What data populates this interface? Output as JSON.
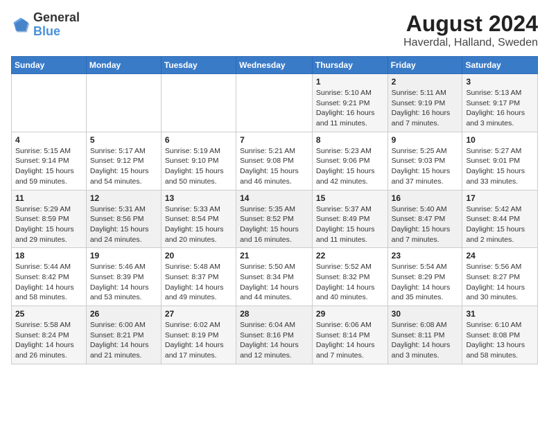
{
  "logo": {
    "line1": "General",
    "line2": "Blue"
  },
  "title": "August 2024",
  "subtitle": "Haverdal, Halland, Sweden",
  "headers": [
    "Sunday",
    "Monday",
    "Tuesday",
    "Wednesday",
    "Thursday",
    "Friday",
    "Saturday"
  ],
  "weeks": [
    [
      {
        "num": "",
        "info": ""
      },
      {
        "num": "",
        "info": ""
      },
      {
        "num": "",
        "info": ""
      },
      {
        "num": "",
        "info": ""
      },
      {
        "num": "1",
        "info": "Sunrise: 5:10 AM\nSunset: 9:21 PM\nDaylight: 16 hours\nand 11 minutes."
      },
      {
        "num": "2",
        "info": "Sunrise: 5:11 AM\nSunset: 9:19 PM\nDaylight: 16 hours\nand 7 minutes."
      },
      {
        "num": "3",
        "info": "Sunrise: 5:13 AM\nSunset: 9:17 PM\nDaylight: 16 hours\nand 3 minutes."
      }
    ],
    [
      {
        "num": "4",
        "info": "Sunrise: 5:15 AM\nSunset: 9:14 PM\nDaylight: 15 hours\nand 59 minutes."
      },
      {
        "num": "5",
        "info": "Sunrise: 5:17 AM\nSunset: 9:12 PM\nDaylight: 15 hours\nand 54 minutes."
      },
      {
        "num": "6",
        "info": "Sunrise: 5:19 AM\nSunset: 9:10 PM\nDaylight: 15 hours\nand 50 minutes."
      },
      {
        "num": "7",
        "info": "Sunrise: 5:21 AM\nSunset: 9:08 PM\nDaylight: 15 hours\nand 46 minutes."
      },
      {
        "num": "8",
        "info": "Sunrise: 5:23 AM\nSunset: 9:06 PM\nDaylight: 15 hours\nand 42 minutes."
      },
      {
        "num": "9",
        "info": "Sunrise: 5:25 AM\nSunset: 9:03 PM\nDaylight: 15 hours\nand 37 minutes."
      },
      {
        "num": "10",
        "info": "Sunrise: 5:27 AM\nSunset: 9:01 PM\nDaylight: 15 hours\nand 33 minutes."
      }
    ],
    [
      {
        "num": "11",
        "info": "Sunrise: 5:29 AM\nSunset: 8:59 PM\nDaylight: 15 hours\nand 29 minutes."
      },
      {
        "num": "12",
        "info": "Sunrise: 5:31 AM\nSunset: 8:56 PM\nDaylight: 15 hours\nand 24 minutes."
      },
      {
        "num": "13",
        "info": "Sunrise: 5:33 AM\nSunset: 8:54 PM\nDaylight: 15 hours\nand 20 minutes."
      },
      {
        "num": "14",
        "info": "Sunrise: 5:35 AM\nSunset: 8:52 PM\nDaylight: 15 hours\nand 16 minutes."
      },
      {
        "num": "15",
        "info": "Sunrise: 5:37 AM\nSunset: 8:49 PM\nDaylight: 15 hours\nand 11 minutes."
      },
      {
        "num": "16",
        "info": "Sunrise: 5:40 AM\nSunset: 8:47 PM\nDaylight: 15 hours\nand 7 minutes."
      },
      {
        "num": "17",
        "info": "Sunrise: 5:42 AM\nSunset: 8:44 PM\nDaylight: 15 hours\nand 2 minutes."
      }
    ],
    [
      {
        "num": "18",
        "info": "Sunrise: 5:44 AM\nSunset: 8:42 PM\nDaylight: 14 hours\nand 58 minutes."
      },
      {
        "num": "19",
        "info": "Sunrise: 5:46 AM\nSunset: 8:39 PM\nDaylight: 14 hours\nand 53 minutes."
      },
      {
        "num": "20",
        "info": "Sunrise: 5:48 AM\nSunset: 8:37 PM\nDaylight: 14 hours\nand 49 minutes."
      },
      {
        "num": "21",
        "info": "Sunrise: 5:50 AM\nSunset: 8:34 PM\nDaylight: 14 hours\nand 44 minutes."
      },
      {
        "num": "22",
        "info": "Sunrise: 5:52 AM\nSunset: 8:32 PM\nDaylight: 14 hours\nand 40 minutes."
      },
      {
        "num": "23",
        "info": "Sunrise: 5:54 AM\nSunset: 8:29 PM\nDaylight: 14 hours\nand 35 minutes."
      },
      {
        "num": "24",
        "info": "Sunrise: 5:56 AM\nSunset: 8:27 PM\nDaylight: 14 hours\nand 30 minutes."
      }
    ],
    [
      {
        "num": "25",
        "info": "Sunrise: 5:58 AM\nSunset: 8:24 PM\nDaylight: 14 hours\nand 26 minutes."
      },
      {
        "num": "26",
        "info": "Sunrise: 6:00 AM\nSunset: 8:21 PM\nDaylight: 14 hours\nand 21 minutes."
      },
      {
        "num": "27",
        "info": "Sunrise: 6:02 AM\nSunset: 8:19 PM\nDaylight: 14 hours\nand 17 minutes."
      },
      {
        "num": "28",
        "info": "Sunrise: 6:04 AM\nSunset: 8:16 PM\nDaylight: 14 hours\nand 12 minutes."
      },
      {
        "num": "29",
        "info": "Sunrise: 6:06 AM\nSunset: 8:14 PM\nDaylight: 14 hours\nand 7 minutes."
      },
      {
        "num": "30",
        "info": "Sunrise: 6:08 AM\nSunset: 8:11 PM\nDaylight: 14 hours\nand 3 minutes."
      },
      {
        "num": "31",
        "info": "Sunrise: 6:10 AM\nSunset: 8:08 PM\nDaylight: 13 hours\nand 58 minutes."
      }
    ]
  ]
}
